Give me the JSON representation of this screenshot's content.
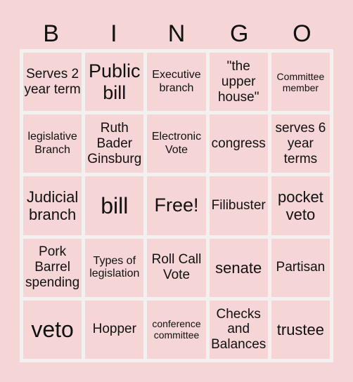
{
  "header": {
    "letters": [
      "B",
      "I",
      "N",
      "G",
      "O"
    ]
  },
  "board": {
    "rows": [
      [
        "Serves 2 year term",
        "Public bill",
        "Executive branch",
        "\"the upper house\"",
        "Committee member"
      ],
      [
        "legislative Branch",
        "Ruth Bader Ginsburg",
        "Electronic Vote",
        "congress",
        "serves 6 year terms"
      ],
      [
        "Judicial branch",
        "bill",
        "Free!",
        "Filibuster",
        "pocket veto"
      ],
      [
        "Pork Barrel spending",
        "Types of legislation",
        "Roll Call Vote",
        "senate",
        "Partisan"
      ],
      [
        "veto",
        "Hopper",
        "conference committee",
        "Checks and Balances",
        "trustee"
      ]
    ]
  },
  "colors": {
    "background": "#f5d5d5",
    "grid_border": "#f3f0f0",
    "text": "#111111"
  }
}
